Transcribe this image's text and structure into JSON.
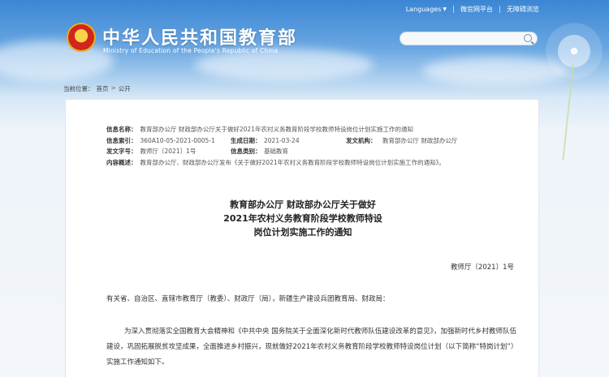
{
  "header": {
    "languages_label": "Languages",
    "top_links": [
      "微官网平台",
      "无障碍浏览"
    ],
    "site_title": "中华人民共和国教育部",
    "site_subtitle": "Ministry of Education of the People's Republic of China",
    "search_placeholder": ""
  },
  "breadcrumb": {
    "prefix": "当前位置：",
    "items": [
      "首页",
      "公开"
    ],
    "separator": ">"
  },
  "meta": {
    "info_name_label": "信息名称：",
    "info_name": "教育部办公厅 财政部办公厅关于做好2021年农村义务教育阶段学校教师特设岗位计划实施工作的通知",
    "index_label": "信息索引：",
    "index": "360A10-05-2021-0005-1",
    "gen_date_label": "生成日期：",
    "gen_date": "2021-03-24",
    "issuer_label": "发文机构：",
    "issuer": "教育部办公厅 财政部办公厅",
    "doc_no_label": "发文字号：",
    "doc_no": "教师厅〔2021〕1号",
    "category_label": "信息类别：",
    "category": "基础教育",
    "summary_label": "内容概述：",
    "summary": "教育部办公厅、财政部办公厅发布《关于做好2021年农村义务教育阶段学校教师特设岗位计划实施工作的通知》。"
  },
  "document": {
    "title_lines": [
      "教育部办公厅 财政部办公厅关于做好",
      "2021年农村义务教育阶段学校教师特设",
      "岗位计划实施工作的通知"
    ],
    "doc_number": "教师厅〔2021〕1号",
    "addressee": "有关省、自治区、直辖市教育厅（教委）、财政厅（局），新疆生产建设兵团教育局、财政局：",
    "paragraph": "为深入贯彻落实全国教育大会精神和《中共中央 国务院关于全面深化新时代教师队伍建设改革的意见》，加强新时代乡村教师队伍建设，巩固拓展脱贫攻坚成果，全面推进乡村振兴，现就做好2021年农村义务教育阶段学校教师特设岗位计划（以下简称“特岗计划”）实施工作通知如下。"
  }
}
